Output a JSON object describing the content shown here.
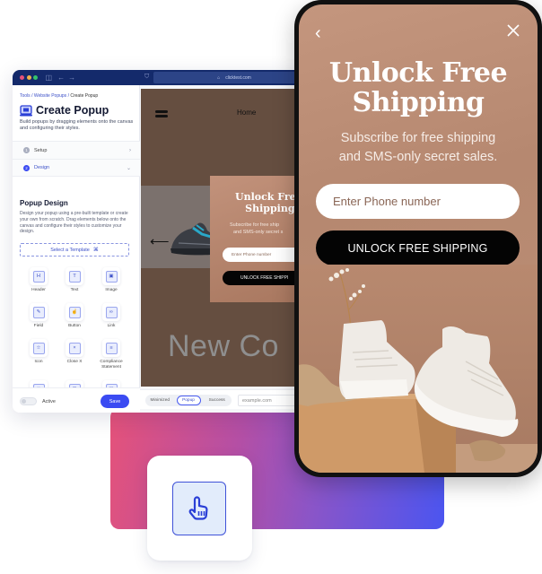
{
  "browser": {
    "url": "clicktest.com",
    "traffic_lights": [
      "#e5527a",
      "#f0b24a",
      "#34c46a"
    ]
  },
  "sidebar": {
    "breadcrumb": [
      "Tools",
      "Website Popups",
      "Create Popup"
    ],
    "breadcrumb_sep": "/",
    "title": "Create Popup",
    "subtitle": "Build popups by dragging elements onto the canvas and configuring their styles.",
    "steps": [
      {
        "num": "1",
        "label": "Setup",
        "state": "collapsed"
      },
      {
        "num": "2",
        "label": "Design",
        "state": "expanded"
      }
    ],
    "design_title": "Popup Design",
    "design_desc": "Design your popup using a pre-built template or create your own from scratch. Drag elements below onto the canvas and configure their styles to customize your design.",
    "template_button": "Select a Template",
    "elements": [
      {
        "label": "Header",
        "icon": "H"
      },
      {
        "label": "Text",
        "icon": "T"
      },
      {
        "label": "Image",
        "icon": "▣"
      },
      {
        "label": "Field",
        "icon": "✎"
      },
      {
        "label": "Button",
        "icon": "☝"
      },
      {
        "label": "Link",
        "icon": "∞"
      },
      {
        "label": "Icon",
        "icon": "☆"
      },
      {
        "label": "Close X",
        "icon": "×"
      },
      {
        "label": "Compliance Statement",
        "icon": "≡"
      },
      {
        "label": "",
        "icon": "□"
      },
      {
        "label": "",
        "icon": "⊟"
      },
      {
        "label": "",
        "icon": "▤"
      }
    ],
    "active_label": "Active",
    "active_on": false,
    "save_label": "Save"
  },
  "canvas": {
    "nav_home": "Home",
    "hero_text": "New Co",
    "mini_popup": {
      "title_line1": "Unlock Fre",
      "title_line2": "Shipping",
      "sub_line1": "Subscribe for free ship",
      "sub_line2": "and SMS-only secret s",
      "input_placeholder": "Enter Phone number",
      "button": "UNLOCK FREE SHIPPI"
    },
    "view_tabs": [
      "Minimized",
      "Popup",
      "Success"
    ],
    "active_view": "Popup",
    "url_placeholder": "example.com"
  },
  "phone": {
    "title_line1": "Unlock Free",
    "title_line2": "Shipping",
    "subtitle_line1": "Subscribe for free shipping",
    "subtitle_line2": "and SMS-only secret sales.",
    "input_placeholder": "Enter Phone number",
    "button": "UNLOCK FREE SHIPPING"
  },
  "colors": {
    "accent": "#3b4bf2",
    "popup_bg": "#b68870",
    "browser_chrome": "#142a6b"
  }
}
